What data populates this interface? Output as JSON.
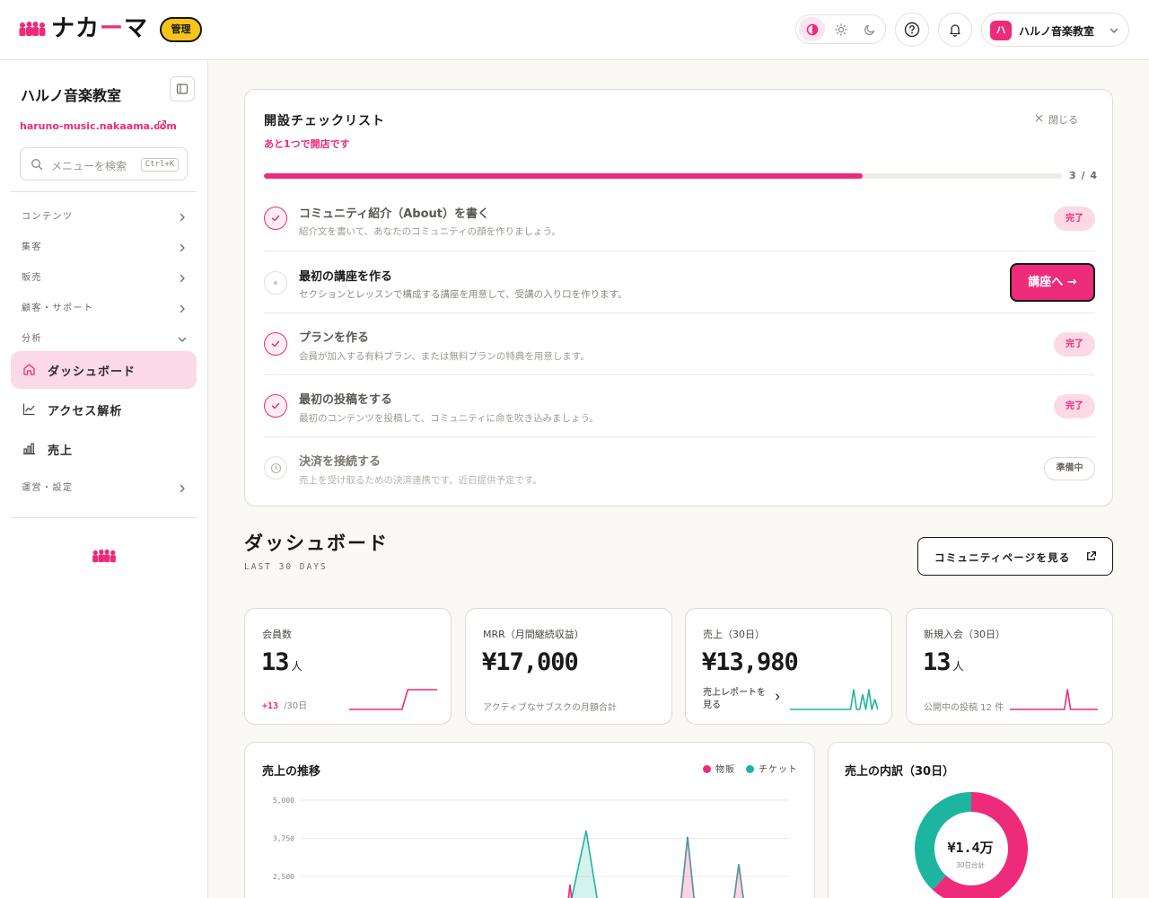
{
  "header": {
    "logo_text_a": "ナカ",
    "logo_text_accent": "ー",
    "logo_text_b": "マ",
    "admin_badge": "管理",
    "theme_modes": [
      "contrast-icon",
      "sun-icon",
      "moon-icon"
    ],
    "active_theme": "contrast",
    "account": {
      "avatar": "ハ",
      "name": "ハルノ音楽教室"
    }
  },
  "sidebar": {
    "title": "ハルノ音楽教室",
    "url": "haruno-music.nakaama.com",
    "search_placeholder": "メニューを検索",
    "search_shortcut": "Ctrl+K",
    "sections": [
      {
        "label": "コンテンツ",
        "expanded": false
      },
      {
        "label": "集客",
        "expanded": false
      },
      {
        "label": "販売",
        "expanded": false
      },
      {
        "label": "顧客・サポート",
        "expanded": false
      },
      {
        "label": "分析",
        "expanded": true
      },
      {
        "label": "運営・設定",
        "expanded": false
      }
    ],
    "analytics_items": [
      {
        "label": "ダッシュボード",
        "icon": "home-icon",
        "active": true
      },
      {
        "label": "アクセス解析",
        "icon": "line-chart-icon",
        "active": false
      },
      {
        "label": "売上",
        "icon": "bar-chart-icon",
        "active": false
      }
    ]
  },
  "checklist": {
    "title": "開設チェックリスト",
    "subtitle": "あと1つで開店です",
    "close_label": "閉じる",
    "progress": 0.75,
    "count": "3 / 4",
    "tasks": [
      {
        "title": "コミュニティ紹介（About）を書く",
        "desc": "紹介文を書いて、あなたのコミュニティの顔を作りましょう。",
        "status": "done",
        "badge": "完了"
      },
      {
        "title": "最初の講座を作る",
        "desc": "セクションとレッスンで構成する講座を用意して、受講の入り口を作ります。",
        "status": "todo",
        "action": "講座へ →"
      },
      {
        "title": "プランを作る",
        "desc": "会員が加入する有料プラン、または無料プランの特典を用意します。",
        "status": "done",
        "badge": "完了"
      },
      {
        "title": "最初の投稿をする",
        "desc": "最初のコンテンツを投稿して、コミュニティに命を吹き込みましょう。",
        "status": "done",
        "badge": "完了"
      },
      {
        "title": "決済を接続する",
        "desc": "売上を受け取るための決済連携です。近日提供予定です。",
        "status": "soon",
        "badge": "準備中"
      }
    ]
  },
  "dashboard": {
    "title": "ダッシュボード",
    "subtitle": "LAST 30 DAYS",
    "community_button": "コミュニティページを見る"
  },
  "kpis": [
    {
      "label": "会員数",
      "value": "13",
      "unit": "人",
      "delta": "+13",
      "delta_period": "/30日",
      "spark": [
        0,
        0,
        0,
        0,
        0,
        0,
        0,
        0,
        0,
        0,
        13,
        13,
        13,
        13,
        13,
        13
      ]
    },
    {
      "label": "MRR（月間継続収益）",
      "value": "¥17,000",
      "unit": "",
      "foot": "アクティブなサブスクの月額合計"
    },
    {
      "label": "売上（30日）",
      "value": "¥13,980",
      "unit": "",
      "link": "売上レポートを見る",
      "spark": [
        0,
        0,
        0,
        0,
        0,
        0,
        0,
        0,
        0,
        0,
        0,
        0,
        0,
        0,
        0,
        0,
        0,
        0,
        0,
        0,
        0,
        4,
        0,
        0,
        3,
        0,
        4,
        0,
        2,
        0
      ]
    },
    {
      "label": "新規入会（30日）",
      "value": "13",
      "unit": "人",
      "foot": "公開中の投稿 12 件",
      "spark": [
        0,
        0,
        0,
        0,
        0,
        0,
        0,
        0,
        0,
        0,
        0,
        0,
        0,
        0,
        0,
        0,
        0,
        0,
        0,
        13,
        0,
        0,
        0,
        0,
        0,
        0,
        0,
        0,
        0,
        0
      ]
    }
  ],
  "colors": {
    "accent": "#ee2b7b",
    "teal": "#1eb5a0",
    "yellow": "#f7c51a"
  },
  "chart_data": [
    {
      "type": "area",
      "title": "売上の推移",
      "series": [
        {
          "name": "物販",
          "color": "#ee2b7b"
        },
        {
          "name": "チケット",
          "color": "#1eb5a0"
        }
      ],
      "y_ticks": [
        "5,000",
        "3,750",
        "2,500"
      ],
      "ylim": [
        0,
        5000
      ],
      "grid": true,
      "legend_position": "top-right",
      "visible_peaks": [
        {
          "series": "チケット",
          "y": 4000
        },
        {
          "series": "物販",
          "y": 3800
        },
        {
          "series": "チケット",
          "y": 2900
        }
      ]
    },
    {
      "type": "pie",
      "title": "売上の内訳（30日）",
      "center_value": "¥1.4万",
      "center_caption": "30日合計",
      "slices": [
        {
          "name": "物販",
          "share": 0.62,
          "color": "#ee2b7b"
        },
        {
          "name": "チケット",
          "share": 0.38,
          "color": "#1eb5a0"
        }
      ]
    }
  ]
}
